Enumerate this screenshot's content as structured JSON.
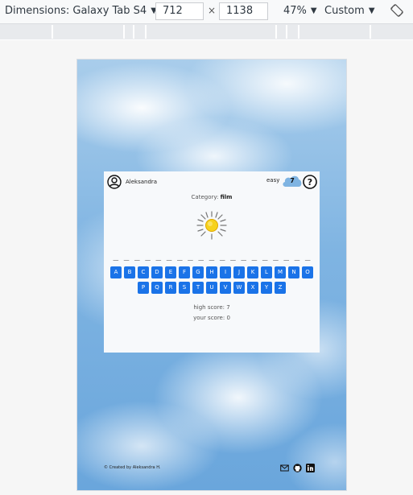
{
  "devtools": {
    "dimensions_label": "Dimensions: Galaxy Tab S4",
    "width_value": "712",
    "times": "×",
    "height_value": "1138",
    "zoom": "47%",
    "throttle": "Custom"
  },
  "header": {
    "username": "Aleksandra",
    "difficulty": "easy",
    "level": "7"
  },
  "game": {
    "category_label": "Category:",
    "category_value": "film",
    "word_pattern": "_ _   _ _ _ _ _ _ _ _   _ _ _   _ _ _   _ _ _",
    "keys_row1": [
      "A",
      "B",
      "C",
      "D",
      "E",
      "F",
      "G",
      "H",
      "I",
      "J",
      "K",
      "L",
      "M",
      "N",
      "O"
    ],
    "keys_row2": [
      "P",
      "Q",
      "R",
      "S",
      "T",
      "U",
      "V",
      "W",
      "X",
      "Y",
      "Z"
    ],
    "high_score": "high score: 7",
    "your_score": "your score: 0"
  },
  "footer": {
    "credit": "© Created by Aleksandra H.",
    "icons": [
      "envelope-icon",
      "github-icon",
      "linkedin-icon"
    ]
  },
  "colors": {
    "key_blue": "#1a73e8",
    "cloud_blue": "#7fb4e2",
    "card_bg": "#f7f9fb"
  }
}
